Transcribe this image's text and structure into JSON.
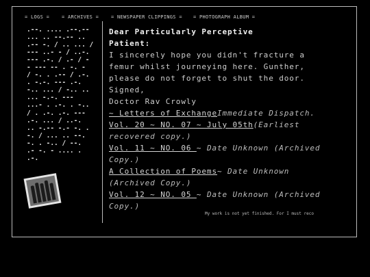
{
  "nav": {
    "logs": "= LOGS =",
    "archives": "= ARCHIVES =",
    "clippings": "= NEWSPAPER CLIPPINGS =",
    "album": "= PHOTOGRAPH ALBUM ="
  },
  "cipher_lines": [
    ".--. .... .--.--",
    "... .. --.-- ..",
    ".-- -. / .. ... /",
    "--- ..- - / ..-.",
    "--- .-. / .- / -",
    "- --- -- . -. -",
    "/ -. . .-- / .-.",
    ". -.-. --- .-.",
    "-.. ... / -.. ..",
    "... -.-. ---",
    "...- . .-. . -..",
    "/ . .-. .-. ---",
    ".-. ... / ..-.",
    ".. -.-- -.- -. .",
    "-. / ... .. --.",
    "-. . -.. / --.",
    ".- -. - .... .",
    ".-."
  ],
  "letter": {
    "greeting_1": "Dear Particularly Perceptive",
    "greeting_2": "Patient:",
    "body_1": "I sincerely hope you didn't fracture a",
    "body_2": "femur whilst journeying here. Gunther,",
    "body_3": "please do not forget to shut the door.",
    "signed": "Signed,",
    "author": "Doctor Rav Crowly"
  },
  "entries": [
    {
      "link": "~ Letters of Exchange",
      "note": "Immediate Dispatch."
    },
    {
      "link": "Vol. 20 ~ NO. 07 ~ July 05th",
      "note": "(Earliest",
      "note_cont": "recovered copy.)"
    },
    {
      "link": "Vol. 11 ~ NO. 06 ",
      "sep": "~ ",
      "note": "Date Unknown (Archived",
      "note_cont": "Copy.)"
    },
    {
      "link": "A Collection of Poems",
      "sep": "~ ",
      "note": "Date Unknown",
      "note_cont": "(Archived Copy.)"
    },
    {
      "link": "Vol. 12 ~ NO. 05 ",
      "sep": "~ ",
      "note": "Date Unknown (Archived",
      "note_cont": "Copy.)"
    }
  ],
  "footer_note": "My work is not yet finished. For I must reco"
}
